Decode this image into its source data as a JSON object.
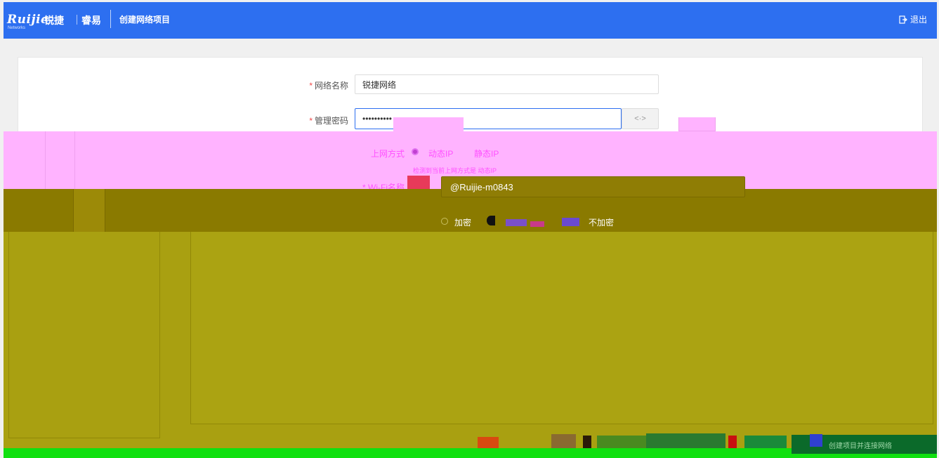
{
  "header": {
    "brand_latin": "Ruijie",
    "brand_cn": "锐捷",
    "brand_sub": "睿易",
    "brand_tag": "Networks",
    "page_title": "创建网络项目",
    "logout_label": "退出"
  },
  "form": {
    "network_name": {
      "label": "网络名称",
      "value": "锐捷网络"
    },
    "admin_password": {
      "label": "管理密码",
      "value": "••••••••••"
    },
    "wan_mode": {
      "label": "上网方式",
      "options": [
        "动态IP",
        "静态IP"
      ],
      "selected": "动态IP",
      "hint": "检测到当前上网方式是 动态IP"
    },
    "wifi_name": {
      "label": "Wi-Fi名称",
      "value": "@Ruijie-m0843"
    },
    "encryption": {
      "options": [
        "加密",
        "不加密"
      ]
    }
  },
  "footer": {
    "submit_label": "创建项目并连接网络"
  },
  "colors": {
    "primary": "#2d6ff0",
    "required": "#f04848"
  }
}
